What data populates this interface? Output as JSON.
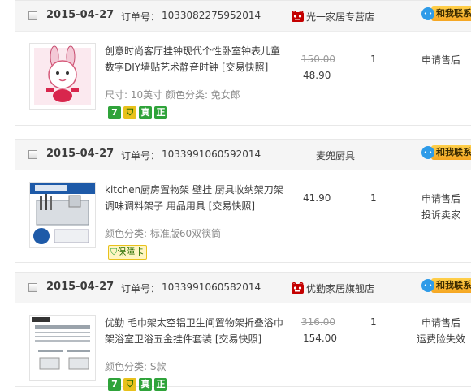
{
  "orders": [
    {
      "date": "2015-04-27",
      "order_no_label": "订单号：",
      "order_no": "1033082275952014",
      "shop_name": "光一家居专营店",
      "shop_icon": "tmall-cat-icon",
      "contact_label": "和我联系",
      "title": "创意时尚客厅挂钟现代个性卧室钟表儿童数字DIY墙贴艺术静音时钟",
      "snapshot": "[交易快照]",
      "sku": "尺寸: 10英寸  颜色分类: 兔女郎",
      "badges": [
        "7",
        "yellow",
        "真",
        "正"
      ],
      "original_price": "150.00",
      "price": "48.90",
      "quantity": "1",
      "actions": [
        "申请售后"
      ]
    },
    {
      "date": "2015-04-27",
      "order_no_label": "订单号：",
      "order_no": "1033991060592014",
      "shop_name": "麦兜厨具",
      "shop_icon": "",
      "contact_label": "和我联系",
      "title": "kitchen厨房置物架 壁挂 厨具收纳架刀架调味调料架子 用品用具",
      "snapshot": "[交易快照]",
      "sku": "颜色分类: 标准版60双筷筒",
      "badges_label": "保障卡",
      "original_price": "",
      "price": "41.90",
      "quantity": "1",
      "actions": [
        "申请售后",
        "投诉卖家"
      ]
    },
    {
      "date": "2015-04-27",
      "order_no_label": "订单号：",
      "order_no": "1033991060582014",
      "shop_name": "优勤家居旗舰店",
      "shop_icon": "tmall-cat-icon",
      "contact_label": "和我联系",
      "title": "优勤 毛巾架太空铝卫生间置物架折叠浴巾架浴室卫浴五金挂件套装",
      "snapshot": "[交易快照]",
      "sku": "颜色分类: S款",
      "badges": [
        "7",
        "yellow",
        "真",
        "正"
      ],
      "original_price": "316.00",
      "price": "154.00",
      "quantity": "1",
      "actions": [
        "申请售后",
        "运费险失效"
      ]
    }
  ],
  "colors": {
    "contact_bg": "#f5a623",
    "badge_green": "#2fa33a",
    "badge_yellow": "#e8c11b",
    "header_bg": "#f5f5f5"
  }
}
